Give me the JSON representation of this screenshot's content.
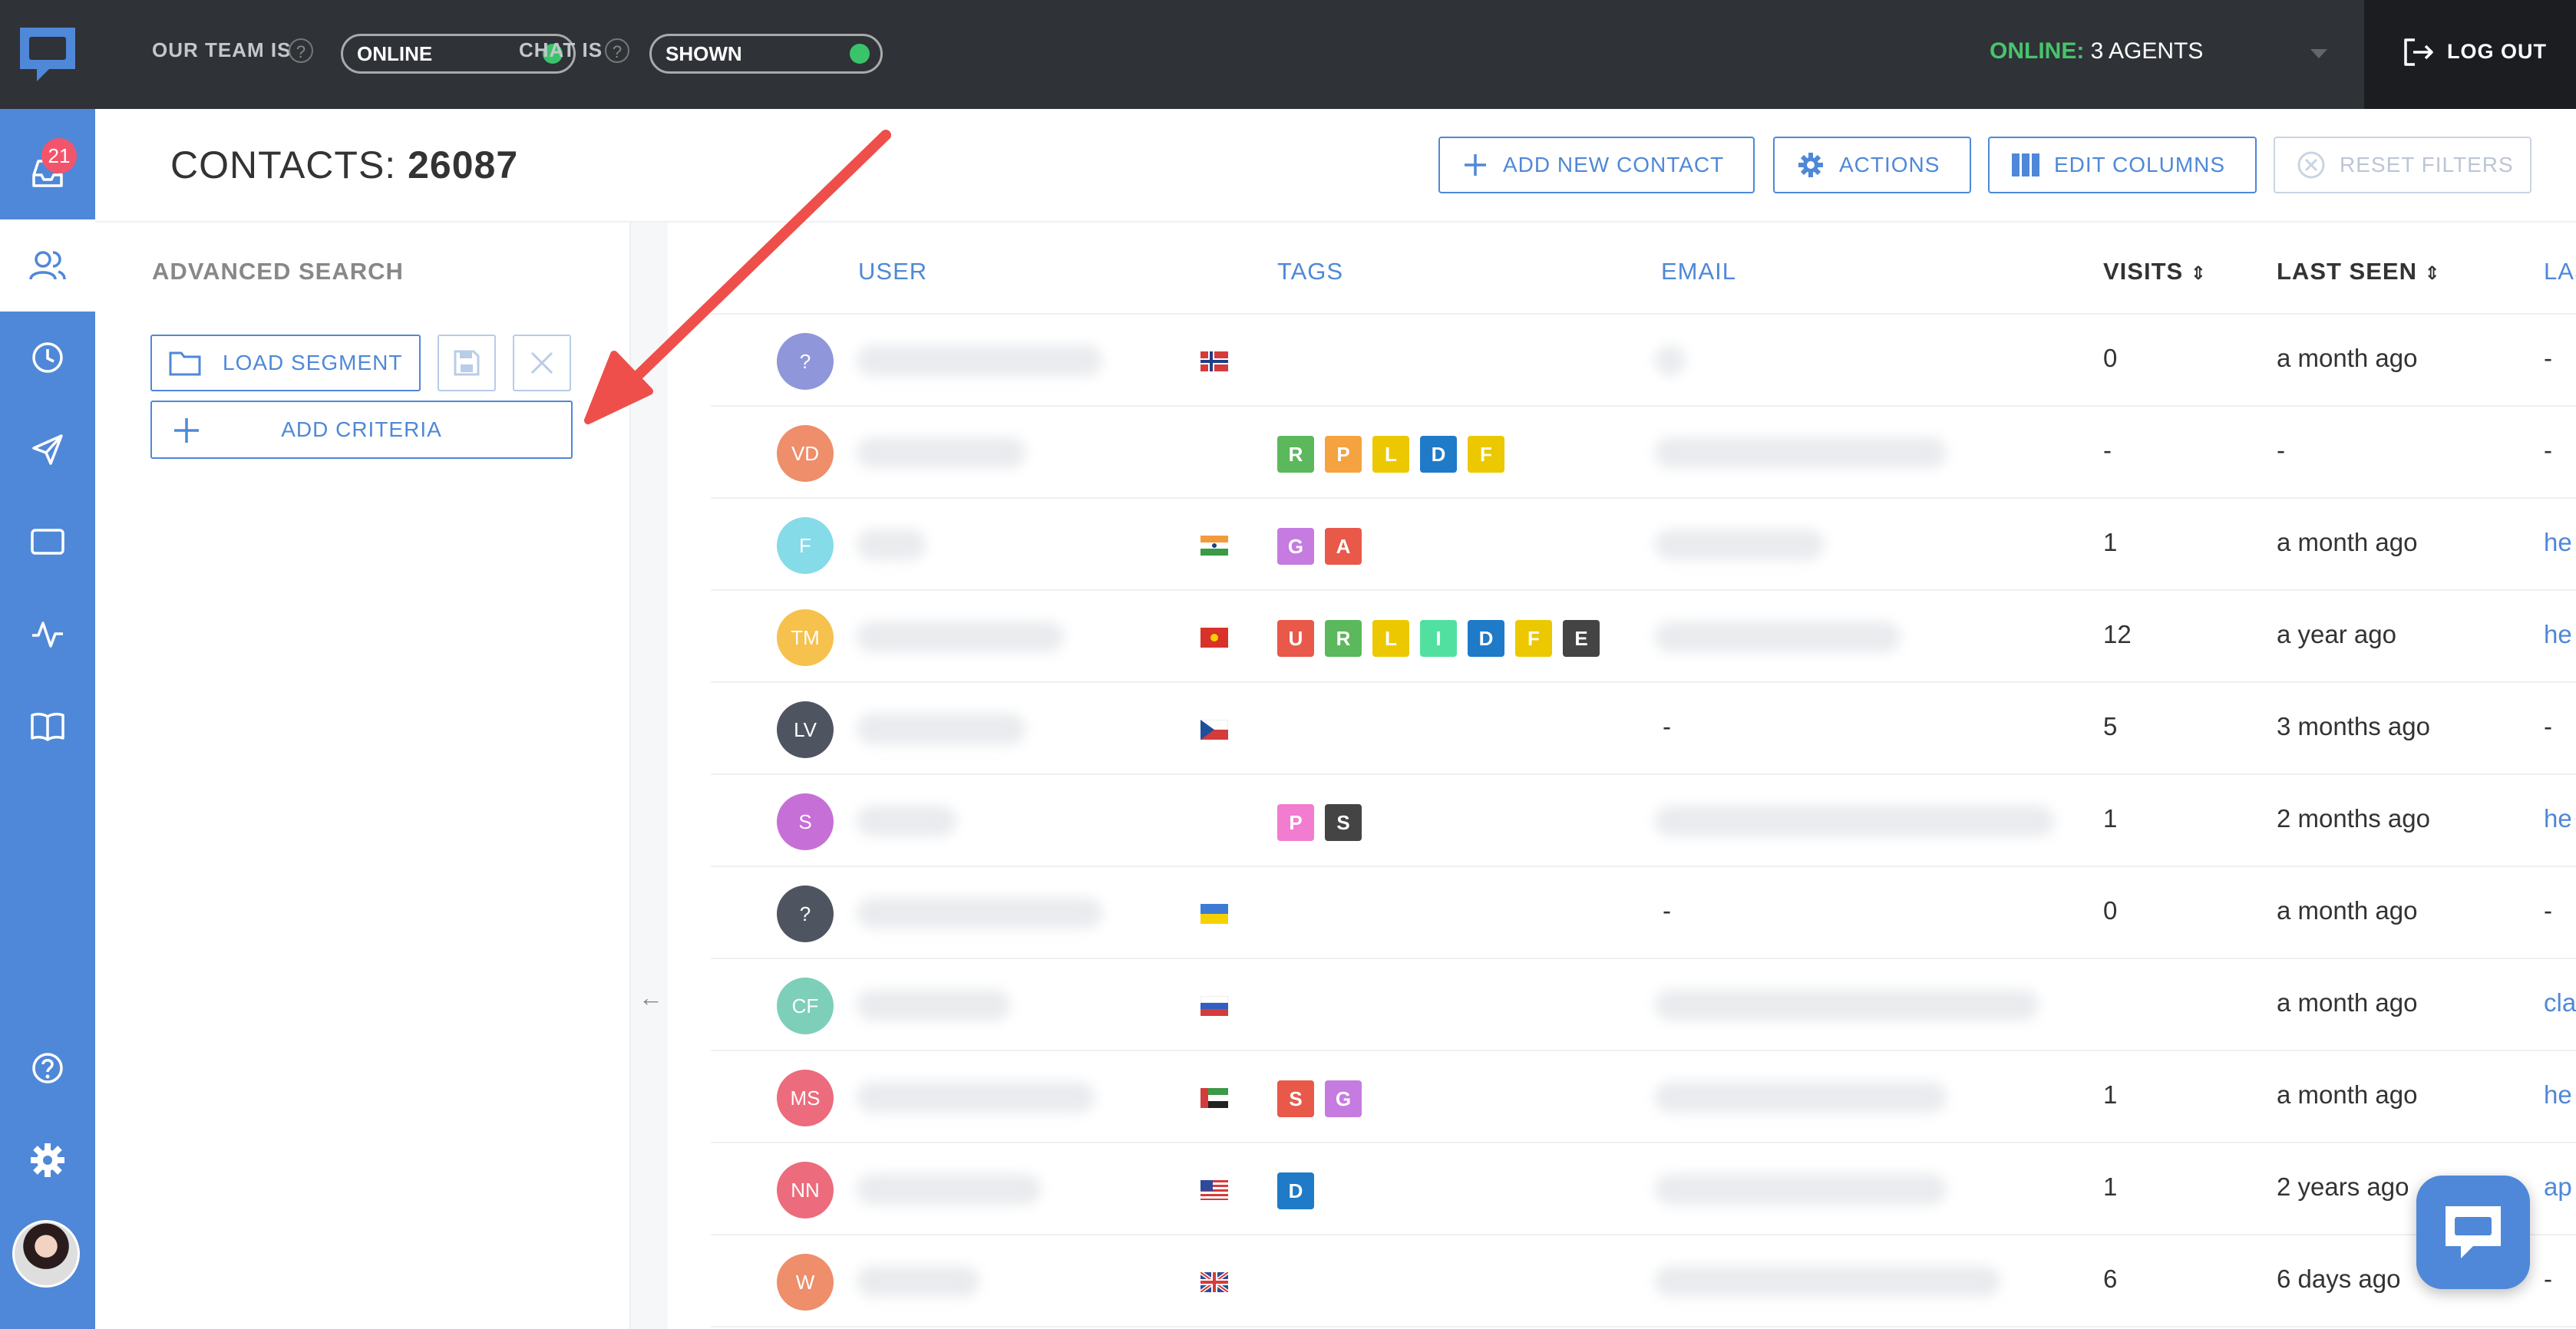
{
  "topbar": {
    "team_label": "OUR TEAM IS",
    "team_status": "ONLINE",
    "chat_label": "CHAT IS",
    "chat_status": "SHOWN",
    "online_key": "ONLINE:",
    "online_value": "3 AGENTS",
    "logout": "LOG OUT"
  },
  "sidebar": {
    "inbox_badge": "21",
    "items": [
      "inbox-icon",
      "contacts-icon",
      "history-icon",
      "send-icon",
      "screen-icon",
      "activity-icon",
      "book-icon",
      "help-icon",
      "settings-icon"
    ]
  },
  "header": {
    "title_label": "CONTACTS:",
    "title_count": "26087",
    "add_contact": "ADD NEW CONTACT",
    "actions": "ACTIONS",
    "edit_columns": "EDIT COLUMNS",
    "reset_filters": "RESET FILTERS"
  },
  "advanced": {
    "title": "ADVANCED SEARCH",
    "load_segment": "LOAD SEGMENT",
    "add_criteria": "ADD CRITERIA"
  },
  "table": {
    "headers": {
      "user": "USER",
      "tags": "TAGS",
      "email": "EMAIL",
      "visits": "VISITS",
      "last_seen": "LAST SEEN",
      "last": "LAS"
    },
    "rows": [
      {
        "initials": "?",
        "color": "#8f96d9",
        "flag": "norway",
        "tags": [],
        "email": "",
        "visits": "0",
        "seen": "a month ago",
        "last": "-"
      },
      {
        "initials": "VD",
        "color": "#ee8e6b",
        "flag": "",
        "tags": [
          [
            "R",
            "#5cb85c"
          ],
          [
            "P",
            "#f4a340"
          ],
          [
            "L",
            "#ecc800"
          ],
          [
            "D",
            "#1f7ac7"
          ],
          [
            "F",
            "#ecc800"
          ]
        ],
        "email": "",
        "visits": "-",
        "seen": "-",
        "last": "-"
      },
      {
        "initials": "F",
        "color": "#86dbe8",
        "flag": "india",
        "tags": [
          [
            "G",
            "#c67be0"
          ],
          [
            "A",
            "#e8594a"
          ]
        ],
        "email": "",
        "visits": "1",
        "seen": "a month ago",
        "last": "he"
      },
      {
        "initials": "TM",
        "color": "#f6c14c",
        "flag": "vietnam",
        "tags": [
          [
            "U",
            "#e8594a"
          ],
          [
            "R",
            "#5cb85c"
          ],
          [
            "L",
            "#ecc800"
          ],
          [
            "I",
            "#52e0a0"
          ],
          [
            "D",
            "#1f7ac7"
          ],
          [
            "F",
            "#ecc800"
          ],
          [
            "E",
            "#444"
          ]
        ],
        "email": "",
        "visits": "12",
        "seen": "a year ago",
        "last": "he"
      },
      {
        "initials": "LV",
        "color": "#4f5560",
        "flag": "czech",
        "tags": [],
        "email": "-",
        "visits": "5",
        "seen": "3 months ago",
        "last": "-"
      },
      {
        "initials": "S",
        "color": "#c66fd6",
        "flag": "",
        "tags": [
          [
            "P",
            "#f27cd0"
          ],
          [
            "S",
            "#444"
          ]
        ],
        "email": "",
        "visits": "1",
        "seen": "2 months ago",
        "last": "he"
      },
      {
        "initials": "?",
        "color": "#4f5560",
        "flag": "ukraine",
        "tags": [],
        "email": "-",
        "visits": "0",
        "seen": "a month ago",
        "last": "-"
      },
      {
        "initials": "CF",
        "color": "#7ecfb9",
        "flag": "russia",
        "tags": [],
        "email": "",
        "visits": "",
        "seen": "a month ago",
        "last": "cla"
      },
      {
        "initials": "MS",
        "color": "#ec6b7c",
        "flag": "uae",
        "tags": [
          [
            "S",
            "#e8594a"
          ],
          [
            "G",
            "#c67be0"
          ]
        ],
        "email": "",
        "visits": "1",
        "seen": "a month ago",
        "last": "he"
      },
      {
        "initials": "NN",
        "color": "#ec6b7c",
        "flag": "usa",
        "tags": [
          [
            "D",
            "#1f7ac7"
          ]
        ],
        "email": "",
        "visits": "1",
        "seen": "2 years ago",
        "last": "ap"
      },
      {
        "initials": "W",
        "color": "#ee8e6b",
        "flag": "uk",
        "tags": [],
        "email": "",
        "visits": "6",
        "seen": "6 days ago",
        "last": "-"
      }
    ]
  }
}
